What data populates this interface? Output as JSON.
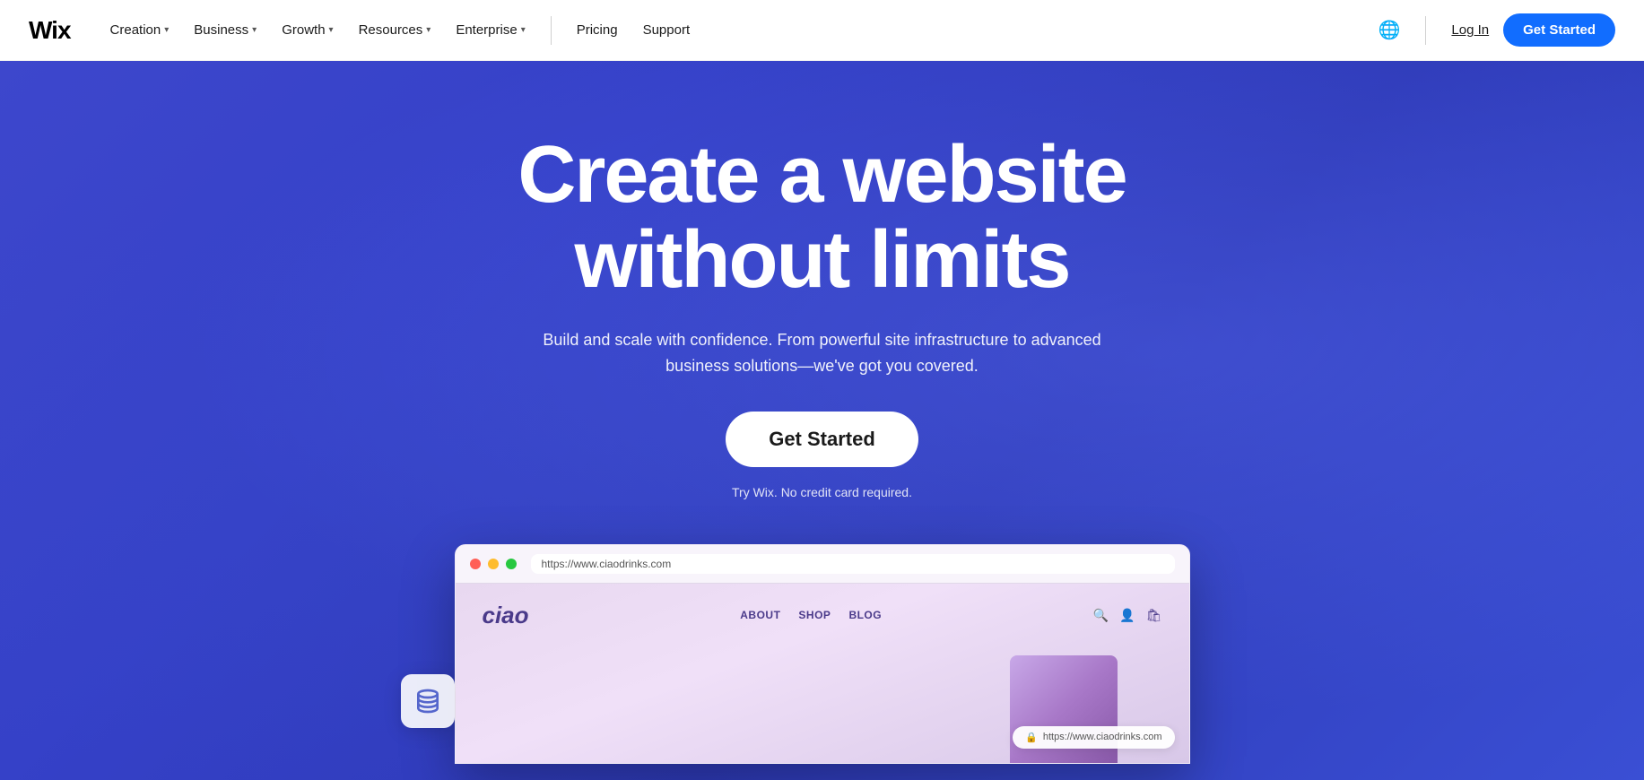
{
  "brand": {
    "logo": "Wix",
    "logo_style": "wix"
  },
  "navbar": {
    "items": [
      {
        "label": "Creation",
        "has_dropdown": true
      },
      {
        "label": "Business",
        "has_dropdown": true
      },
      {
        "label": "Growth",
        "has_dropdown": true
      },
      {
        "label": "Resources",
        "has_dropdown": true
      },
      {
        "label": "Enterprise",
        "has_dropdown": true
      }
    ],
    "right_items": [
      {
        "label": "Pricing",
        "has_dropdown": false
      },
      {
        "label": "Support",
        "has_dropdown": false
      }
    ],
    "login_label": "Log In",
    "cta_label": "Get Started"
  },
  "hero": {
    "headline_line1": "Create a website",
    "headline_line2": "without limits",
    "subtext": "Build and scale with confidence. From powerful site infrastructure to advanced business solutions—we've got you covered.",
    "cta_label": "Get Started",
    "no_card_text": "Try Wix. No credit card required."
  },
  "browser_mockup": {
    "url": "https://www.ciaodrinks.com",
    "site_logo": "ciao",
    "site_nav": [
      "ABOUT",
      "SHOP",
      "BLOG"
    ],
    "lock_icon": "🔒"
  }
}
